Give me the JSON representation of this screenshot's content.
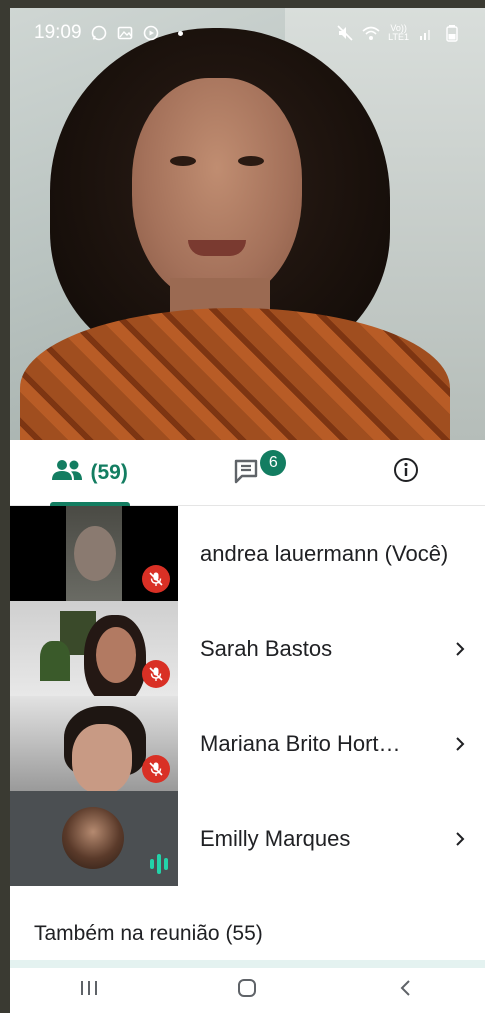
{
  "status_bar": {
    "time": "19:09",
    "network_label_top": "Vo))",
    "network_label_bottom": "LTE1"
  },
  "tabs": {
    "people_count": "(59)",
    "chat_badge": "6"
  },
  "participants": [
    {
      "name": "andrea lauermann (Você)",
      "muted": true,
      "has_chevron": false
    },
    {
      "name": "Sarah Bastos",
      "muted": true,
      "has_chevron": true
    },
    {
      "name": "Mariana Brito Hort…",
      "muted": true,
      "has_chevron": true
    },
    {
      "name": "Emilly Marques",
      "muted": false,
      "speaking": true,
      "has_chevron": true
    }
  ],
  "also_in_meeting": "Também na reunião (55)",
  "colors": {
    "accent": "#137d61",
    "muted_red": "#d93025",
    "speaking_teal": "#23d3a9"
  },
  "icons": [
    "whatsapp-icon",
    "gallery-icon",
    "youtube-icon",
    "mute-icon",
    "wifi-icon",
    "signal-icon",
    "battery-icon",
    "people-icon",
    "chat-icon",
    "info-icon",
    "mic-off-icon",
    "chevron-right-icon",
    "recents-icon",
    "home-icon",
    "back-icon"
  ]
}
